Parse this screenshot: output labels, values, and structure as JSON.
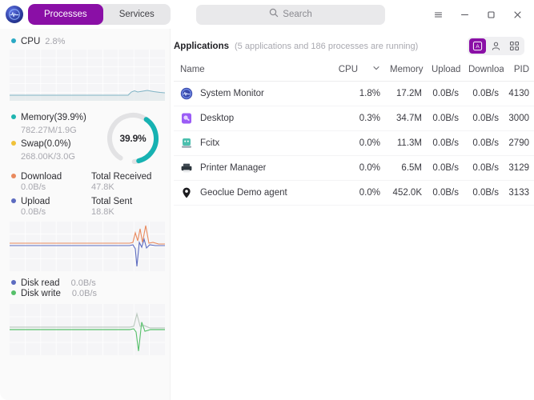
{
  "titlebar": {
    "logo_icon": "system-monitor-logo-icon",
    "tabs": [
      {
        "label": "Processes",
        "active": true
      },
      {
        "label": "Services",
        "active": false
      }
    ],
    "search": {
      "placeholder": "Search",
      "value": "",
      "icon": "search-icon"
    },
    "controls": [
      {
        "name": "menu-button",
        "icon": "hamburger-icon",
        "glyph": "≡"
      },
      {
        "name": "minimize-button",
        "icon": "minimize-icon",
        "glyph": "–"
      },
      {
        "name": "maximize-button",
        "icon": "maximize-icon",
        "glyph": "□"
      },
      {
        "name": "close-button",
        "icon": "close-icon",
        "glyph": "✕"
      }
    ]
  },
  "sidebar": {
    "cpu": {
      "label": "CPU",
      "value": "2.8%",
      "dot_color": "#2aa9c4"
    },
    "memory": {
      "label": "Memory(39.9%)",
      "detail": "782.27M/1.9G",
      "dot_color": "#1fb5b0",
      "swap_label": "Swap(0.0%)",
      "swap_detail": "268.00K/3.0G",
      "swap_dot_color": "#f0c23a",
      "donut_percent": "39.9%",
      "donut_value": 39.9,
      "donut_color": "#17b2b2",
      "donut_track": "#e2e2e4"
    },
    "network": {
      "download_label": "Download",
      "download_value": "0.0B/s",
      "download_dot_color": "#e98a5e",
      "upload_label": "Upload",
      "upload_value": "0.0B/s",
      "upload_dot_color": "#5c6bc0",
      "total_received_label": "Total Received",
      "total_received_value": "47.8K",
      "total_sent_label": "Total Sent",
      "total_sent_value": "18.8K"
    },
    "disk": {
      "read_label": "Disk read",
      "read_value": "0.0B/s",
      "read_dot_color": "#5c6bc0",
      "write_label": "Disk write",
      "write_value": "0.0B/s",
      "write_dot_color": "#56c06a"
    }
  },
  "main": {
    "title": "Applications",
    "subtitle": "(5 applications and 186 processes are running)",
    "view_modes": [
      {
        "name": "view-applications",
        "icon": "application-window-icon",
        "active": true
      },
      {
        "name": "view-my-processes",
        "icon": "user-icon",
        "active": false
      },
      {
        "name": "view-all-processes",
        "icon": "grid-processes-icon",
        "active": false
      }
    ],
    "columns": [
      {
        "key": "name",
        "label": "Name"
      },
      {
        "key": "cpu",
        "label": "CPU",
        "sorted": true,
        "sort_icon": "chevron-down-icon"
      },
      {
        "key": "memory",
        "label": "Memory"
      },
      {
        "key": "upload",
        "label": "Upload"
      },
      {
        "key": "download",
        "label": "Downloa"
      },
      {
        "key": "pid",
        "label": "PID"
      }
    ],
    "rows": [
      {
        "icon": "system-monitor-app-icon",
        "name": "System Monitor",
        "cpu": "1.8%",
        "memory": "17.2M",
        "upload": "0.0B/s",
        "download": "0.0B/s",
        "pid": "4130"
      },
      {
        "icon": "desktop-app-icon",
        "name": "Desktop",
        "cpu": "0.3%",
        "memory": "34.7M",
        "upload": "0.0B/s",
        "download": "0.0B/s",
        "pid": "3000"
      },
      {
        "icon": "fcitx-keyboard-icon",
        "name": "Fcitx",
        "cpu": "0.0%",
        "memory": "11.3M",
        "upload": "0.0B/s",
        "download": "0.0B/s",
        "pid": "2790"
      },
      {
        "icon": "printer-icon",
        "name": "Printer Manager",
        "cpu": "0.0%",
        "memory": "6.5M",
        "upload": "0.0B/s",
        "download": "0.0B/s",
        "pid": "3129"
      },
      {
        "icon": "location-pin-icon",
        "name": "Geoclue Demo agent",
        "cpu": "0.0%",
        "memory": "452.0K",
        "upload": "0.0B/s",
        "download": "0.0B/s",
        "pid": "3133"
      }
    ]
  },
  "theme": {
    "accent": "#8a0fa6",
    "teal": "#17b2b2",
    "sidebar_bg": "#fafafa"
  }
}
